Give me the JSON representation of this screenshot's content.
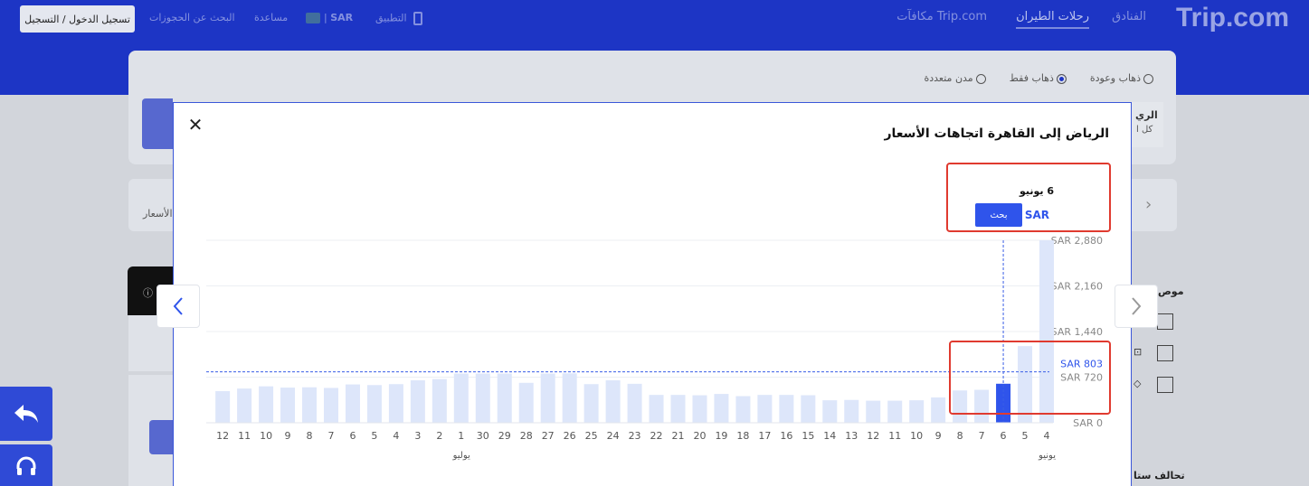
{
  "header": {
    "brand": "Trip.com",
    "nav": [
      "الفنادق",
      "رحلات الطيران",
      "مكافآت Trip.com"
    ],
    "app_label": "التطبيق",
    "currency": "SAR",
    "help": "مساعدة",
    "find_bookings": "البحث عن الحجوزات",
    "login": "تسجيل الدخول / التسجيل"
  },
  "search": {
    "trip_types": [
      "ذهاب وعودة",
      "ذهاب فقط",
      "مدن متعددة"
    ],
    "selected_trip_type": "ذهاب فقط",
    "partial_texts": [
      "الري",
      "كل ا",
      "الأسعار",
      "موص",
      "تحالف ستا"
    ]
  },
  "modal": {
    "title": "الرياض إلى القاهرة اتجاهات الأسعار",
    "tooltip": {
      "date": "6 يونيو",
      "currency": "SAR",
      "search_button": "بحث"
    },
    "icons": {
      "close": "close-icon",
      "prev": "chevron-left-icon",
      "next": "chevron-right-icon"
    }
  },
  "side_buttons": [
    "back-arrow-icon",
    "headset-icon"
  ],
  "colors": {
    "brand": "#1d35c5",
    "bar": "#dde6fa",
    "bar_selected": "#2f54eb",
    "highlight": "#e03a2f"
  },
  "chart_data": {
    "type": "bar",
    "categories": [
      "4",
      "5",
      "6",
      "7",
      "8",
      "9",
      "10",
      "11",
      "12",
      "13",
      "14",
      "15",
      "16",
      "17",
      "18",
      "19",
      "20",
      "21",
      "22",
      "23",
      "24",
      "25",
      "26",
      "27",
      "28",
      "29",
      "30",
      "1",
      "2",
      "3",
      "4",
      "5",
      "6",
      "7",
      "8",
      "9",
      "10",
      "11",
      "12"
    ],
    "month_labels": [
      {
        "index": 0,
        "label": "يونيو"
      },
      {
        "index": 27,
        "label": "يوليو"
      }
    ],
    "values": [
      2880,
      1210,
      616,
      520,
      510,
      400,
      355,
      348,
      348,
      360,
      355,
      435,
      440,
      440,
      420,
      455,
      434,
      440,
      440,
      615,
      670,
      610,
      780,
      776,
      630,
      776,
      776,
      776,
      690,
      670,
      610,
      595,
      605,
      550,
      560,
      555,
      575,
      540,
      500
    ],
    "selected_index": 2,
    "reference_line": 803,
    "reference_label": "SAR 803",
    "y_ticks": [
      "SAR 0",
      "SAR 720",
      "SAR 1,440",
      "SAR 2,160",
      "SAR 2,880"
    ],
    "ylim": [
      0,
      2880
    ]
  }
}
